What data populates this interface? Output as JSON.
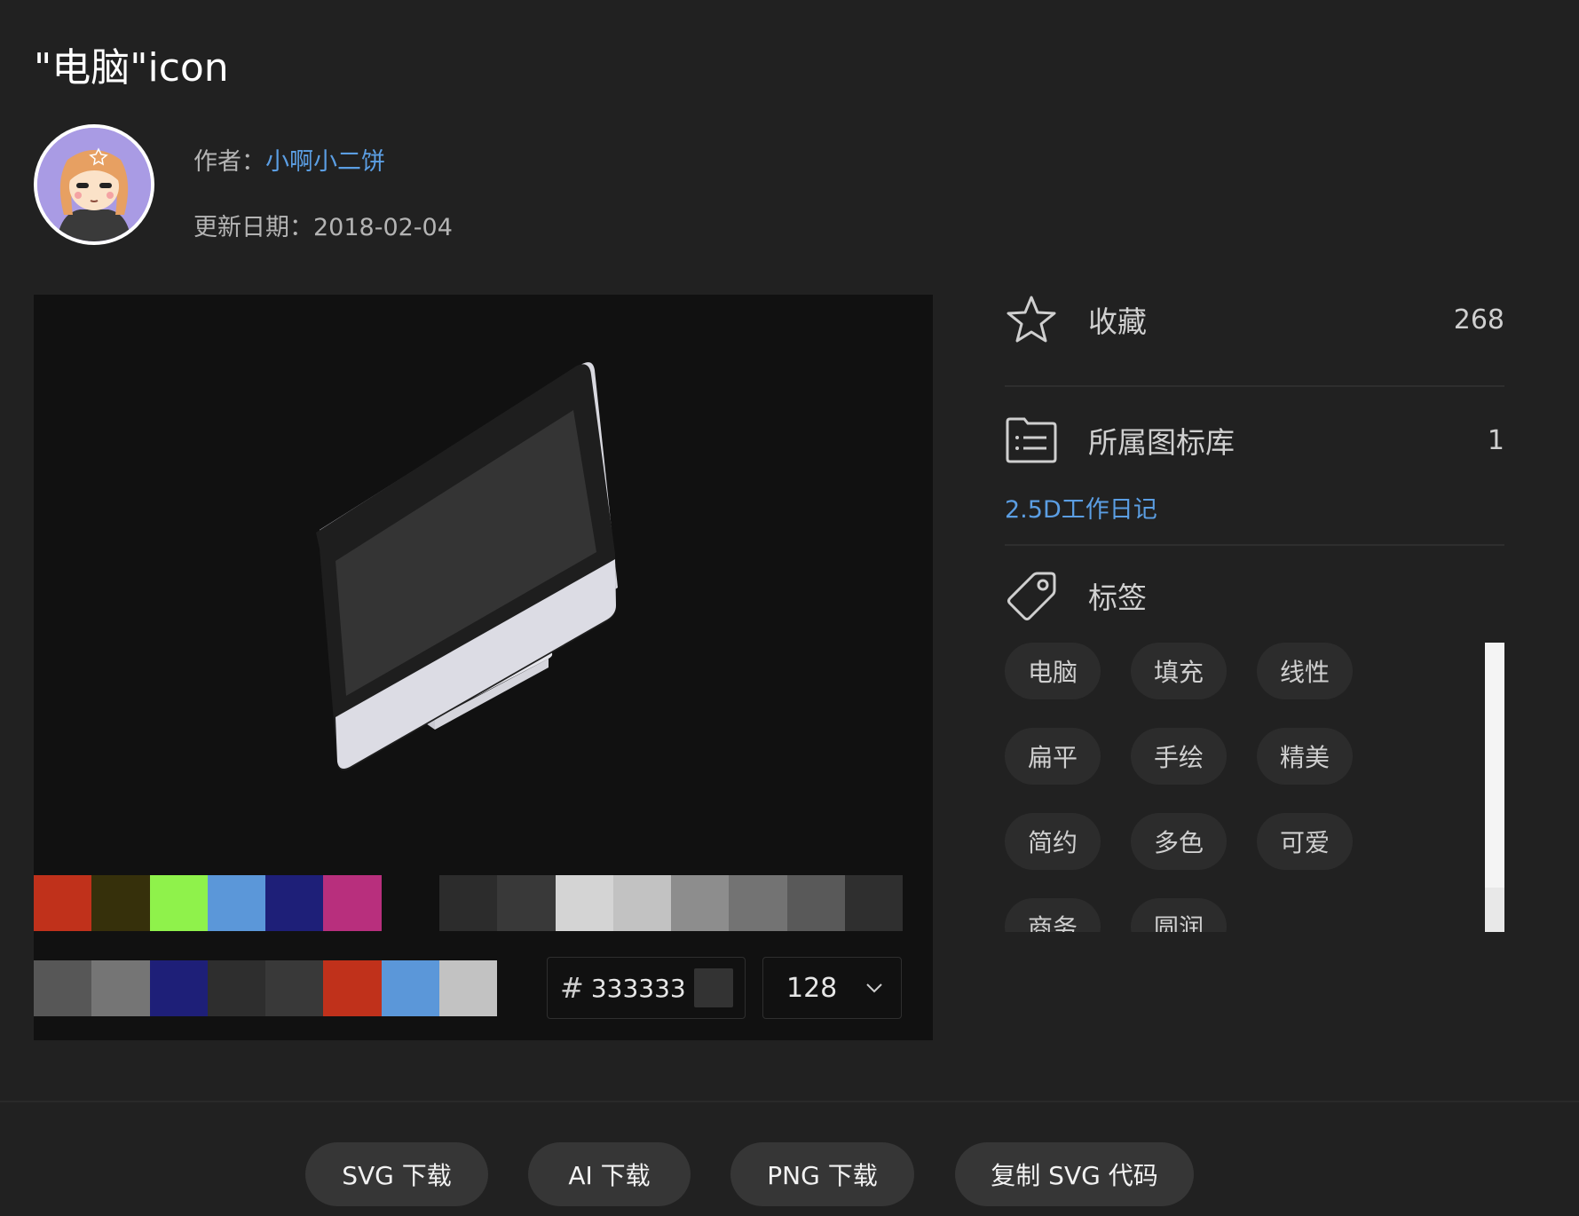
{
  "header": {
    "title": "\"电脑\"icon"
  },
  "author": {
    "label": "作者：",
    "name": "小啊小二饼",
    "date_label": "更新日期：",
    "date": "2018-02-04"
  },
  "stats": {
    "favorite": {
      "label": "收藏",
      "count": "268",
      "icon": "star-icon"
    },
    "library": {
      "label": "所属图标库",
      "count": "1",
      "icon": "folder-list-icon",
      "link": "2.5D工作日记"
    },
    "tags": {
      "label": "标签",
      "icon": "tag-icon"
    }
  },
  "tags": [
    "电脑",
    "填充",
    "线性",
    "扁平",
    "手绘",
    "精美",
    "简约",
    "多色",
    "可爱",
    "商务",
    "圆润"
  ],
  "palettes": {
    "row1": [
      "#c0311b",
      "#36300b",
      "#8ff24b",
      "#5b97d9",
      "#1e1f78",
      "#b82f7d"
    ],
    "row2": [
      "#2c2c2c",
      "#393939",
      "#d4d4d4",
      "#c2c2c2",
      "#8d8d8d",
      "#737373",
      "#595959",
      "#2f2f2f"
    ],
    "row3": [
      "#575757",
      "#757575",
      "#1e1f78",
      "#2e2e2e",
      "#393939",
      "#c0311b",
      "#5b97d9",
      "#c2c2c2"
    ]
  },
  "color_input": {
    "hash": "#",
    "value": "333333",
    "swatch": "#333333"
  },
  "size_select": {
    "value": "128"
  },
  "actions": {
    "svg": "SVG 下载",
    "ai": "AI 下载",
    "png": "PNG 下载",
    "copy": "复制 SVG 代码"
  }
}
